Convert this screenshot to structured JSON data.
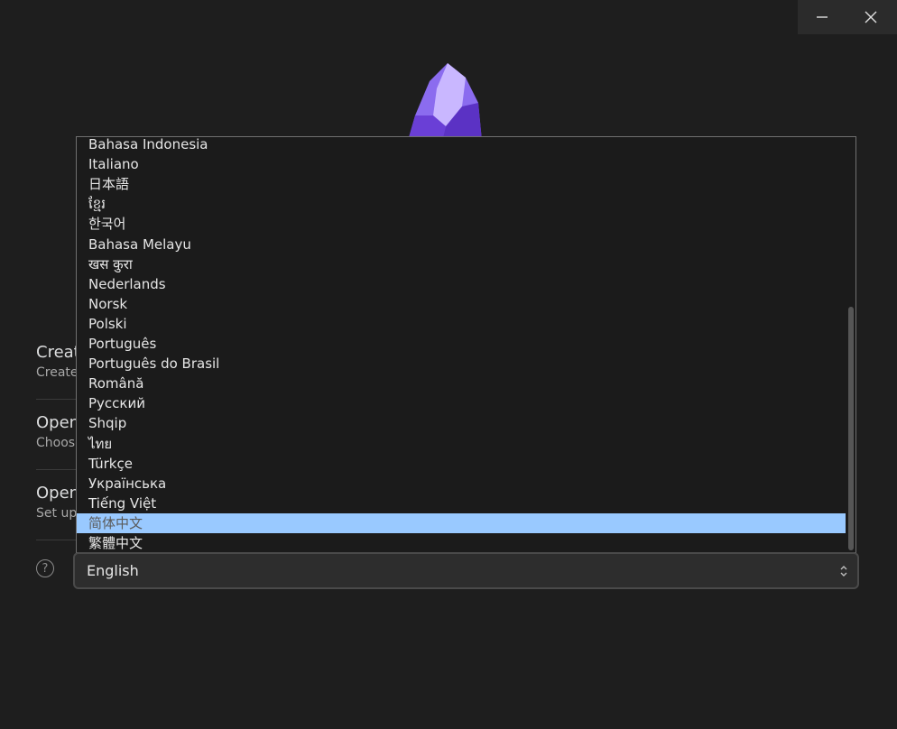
{
  "window": {
    "minimize_icon": "minimize-icon",
    "close_icon": "close-icon"
  },
  "menu": [
    {
      "title": "Create",
      "desc": "Create"
    },
    {
      "title": "Open",
      "desc": "Choose"
    },
    {
      "title": "Open",
      "desc": "Set up"
    }
  ],
  "language_options": [
    "Bahasa Indonesia",
    "Italiano",
    "日本語",
    "ខ្មែរ",
    "한국어",
    "Bahasa Melayu",
    "खस कुरा",
    "Nederlands",
    "Norsk",
    "Polski",
    "Português",
    "Português do Brasil",
    "Română",
    "Русский",
    "Shqip",
    "ไทย",
    "Türkçe",
    "Українська",
    "Tiếng Việt",
    "简体中文",
    "繁體中文"
  ],
  "highlighted_option": "简体中文",
  "language_select": {
    "value": "English"
  },
  "colors": {
    "highlight": "#99c9ff",
    "background": "#1e1e1e",
    "logo": "#8b6cef"
  }
}
